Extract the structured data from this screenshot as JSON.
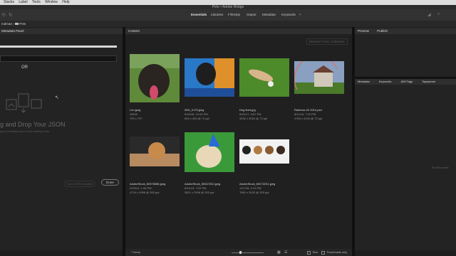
{
  "menubar": {
    "items": [
      "Stacks",
      "Label",
      "Tools",
      "Window",
      "Help"
    ]
  },
  "titlebar": {
    "title": "Pets • Adobe Bridge"
  },
  "workspaces": [
    "Essentials",
    "Libraries",
    "Filmstrip",
    "Output",
    "Metadata",
    "Keywords"
  ],
  "path": {
    "crumb1": "mdman",
    "crumb2": "Pets"
  },
  "left_panel": {
    "tab": "Metadata Panel",
    "or_label": "OR",
    "drag_text": "g and Drop Your JSON",
    "sub_text": "your metadata panel view settings here",
    "save_button": "Save JSON headink",
    "done_button": "Done"
  },
  "content": {
    "tab": "Content",
    "remove_button": "Remove From Collection",
    "items": [
      {
        "filename": "Leo.jpeg",
        "date": "4/6/20",
        "dims": "720 x 707",
        "kind": "dog-grass"
      },
      {
        "filename": "IMG_0175.jpeg",
        "date": "5/16/16, 12:04 PM",
        "dims": "604 x 453 @ 72 ppi",
        "kind": "dog-blue"
      },
      {
        "filename": "Dog tired.jpg",
        "date": "8/10/17, 4:57 PM",
        "dims": "4032 x 3024 @ 72 ppi",
        "kind": "dog-lying"
      },
      {
        "filename": "Rainbow #2 2014.psd",
        "date": "8/11/16, 7:22 PM",
        "dims": "4784 x 3194 @ 72 ppi",
        "kind": "house"
      },
      {
        "filename": "AdobeStock_69378386.jpeg",
        "date": "2/23/14, 1:45 PM",
        "dims": "4724 x 2998 @ 300 ppi",
        "kind": "puppy-board"
      },
      {
        "filename": "AdobeStock_55347202.jpeg",
        "date": "8/14/13, 7:22 PM",
        "dims": "3821 x 3306 @ 300 ppi",
        "kind": "dog-hat"
      },
      {
        "filename": "AdobeStock_69272231.jpeg",
        "date": "1/17/15, 9:13 PM",
        "dims": "7852 x 3022 @ 300 ppi",
        "kind": "puppies-row"
      }
    ],
    "status": "7 items",
    "tiles_label": "Tiles",
    "thumbs_only_label": "Thumbnails only"
  },
  "right_panel": {
    "tabs_top": [
      "Preview",
      "Publish"
    ],
    "tabs_meta": [
      "Metadata",
      "Keywords",
      "AIM Tags",
      "Tapepmae"
    ],
    "empty_text": "No files selec"
  }
}
